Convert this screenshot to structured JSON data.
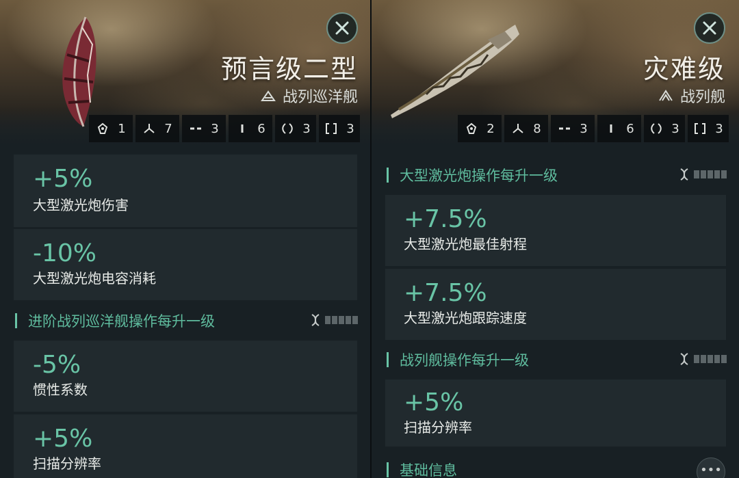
{
  "left_panel": {
    "ship_name": "预言级二型",
    "ship_class": "战列巡洋舰",
    "slots": [
      {
        "icon": "high-slot-icon",
        "count": "1"
      },
      {
        "icon": "turret-icon",
        "count": "7"
      },
      {
        "icon": "mid-slot-icon",
        "count": "3"
      },
      {
        "icon": "low-slot-icon",
        "count": "6"
      },
      {
        "icon": "rig-icon",
        "count": "3"
      },
      {
        "icon": "subsystem-icon",
        "count": "3"
      }
    ],
    "bonuses_top": [
      {
        "value": "+5%",
        "desc": "大型激光炮伤害"
      },
      {
        "value": "-10%",
        "desc": "大型激光炮电容消耗"
      }
    ],
    "section": {
      "title": "进阶战列巡洋舰操作每升一级",
      "bonuses": [
        {
          "value": "-5%",
          "desc": "惯性系数"
        },
        {
          "value": "+5%",
          "desc": "扫描分辨率"
        }
      ]
    }
  },
  "right_panel": {
    "ship_name": "灾难级",
    "ship_class": "战列舰",
    "slots": [
      {
        "icon": "high-slot-icon",
        "count": "2"
      },
      {
        "icon": "turret-icon",
        "count": "8"
      },
      {
        "icon": "mid-slot-icon",
        "count": "3"
      },
      {
        "icon": "low-slot-icon",
        "count": "6"
      },
      {
        "icon": "rig-icon",
        "count": "3"
      },
      {
        "icon": "subsystem-icon",
        "count": "3"
      }
    ],
    "section1": {
      "title": "大型激光炮操作每升一级",
      "bonuses": [
        {
          "value": "+7.5%",
          "desc": "大型激光炮最佳射程"
        },
        {
          "value": "+7.5%",
          "desc": "大型激光炮跟踪速度"
        }
      ]
    },
    "section2": {
      "title": "战列舰操作每升一级",
      "bonuses": [
        {
          "value": "+5%",
          "desc": "扫描分辨率"
        }
      ]
    },
    "section3": {
      "title": "基础信息"
    },
    "more_label": "•••"
  },
  "colors": {
    "accent": "#69c4a6",
    "card_bg": "#212a2e",
    "panel_bg": "#182024"
  }
}
